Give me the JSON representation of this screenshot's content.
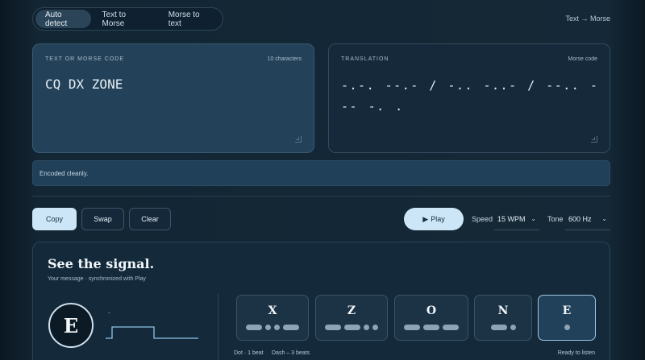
{
  "modes": [
    {
      "label": "Auto detect",
      "active": true
    },
    {
      "label": "Text to Morse",
      "active": false
    },
    {
      "label": "Morse to text",
      "active": false
    }
  ],
  "direction": "Text → Morse",
  "input": {
    "title": "TEXT OR MORSE CODE",
    "count": "10 characters",
    "value": "CQ DX ZONE"
  },
  "output": {
    "title": "TRANSLATION",
    "kind": "Morse code",
    "value": "-.-. --.- / -.. -..- / --.. --- -. ."
  },
  "status": "Encoded cleanly.",
  "actions": {
    "copy": "Copy",
    "swap": "Swap",
    "clear": "Clear"
  },
  "playback": {
    "play": "Play",
    "play_icon": "▶",
    "speed_label": "Speed",
    "speed_value": "15 WPM",
    "tone_label": "Tone",
    "tone_value": "600 Hz"
  },
  "signal": {
    "title": "See the signal.",
    "subtitle": "Your message · synchronized with Play",
    "current_letter": "E",
    "current_symbol_text": ".",
    "letters": [
      {
        "char": "X",
        "code": "-..-",
        "active": false
      },
      {
        "char": "Z",
        "code": "--..",
        "active": false
      },
      {
        "char": "O",
        "code": "---",
        "active": false
      },
      {
        "char": "N",
        "code": "-.",
        "active": false
      },
      {
        "char": "E",
        "code": ".",
        "active": true
      }
    ],
    "legend_dot": "Dot · 1 beat",
    "legend_dash": "Dash – 3 beats",
    "ready": "Ready to listen"
  },
  "colors": {
    "accent": "#cde6f7",
    "mark": "#8ea3b3",
    "wave": "#8fc3e3"
  }
}
